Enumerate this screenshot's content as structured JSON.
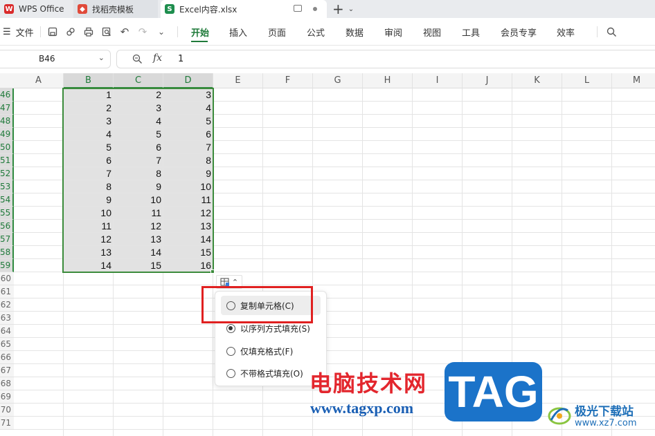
{
  "tabs": {
    "wps": "WPS Office",
    "template": "找稻壳模板",
    "file": "Excel内容.xlsx",
    "file_icon": "S"
  },
  "ribbon": {
    "file_menu": "文件",
    "menus": [
      "开始",
      "插入",
      "页面",
      "公式",
      "数据",
      "审阅",
      "视图",
      "工具",
      "会员专享",
      "效率"
    ]
  },
  "formula_bar": {
    "cell_ref": "B46",
    "fx": "fx",
    "value": "1"
  },
  "sheet": {
    "columns": [
      "A",
      "B",
      "C",
      "D",
      "E",
      "F",
      "G",
      "H",
      "I",
      "J",
      "K",
      "L",
      "M"
    ],
    "rows": [
      "46",
      "47",
      "48",
      "49",
      "50",
      "51",
      "52",
      "53",
      "54",
      "55",
      "56",
      "57",
      "58",
      "59",
      "60",
      "61",
      "62",
      "63",
      "64",
      "65",
      "66",
      "67",
      "68",
      "69",
      "70",
      "71"
    ],
    "data": [
      [
        "1",
        "2",
        "3"
      ],
      [
        "2",
        "3",
        "4"
      ],
      [
        "3",
        "4",
        "5"
      ],
      [
        "4",
        "5",
        "6"
      ],
      [
        "5",
        "6",
        "7"
      ],
      [
        "6",
        "7",
        "8"
      ],
      [
        "7",
        "8",
        "9"
      ],
      [
        "8",
        "9",
        "10"
      ],
      [
        "9",
        "10",
        "11"
      ],
      [
        "10",
        "11",
        "12"
      ],
      [
        "11",
        "12",
        "13"
      ],
      [
        "12",
        "13",
        "14"
      ],
      [
        "13",
        "14",
        "15"
      ],
      [
        "14",
        "15",
        "16"
      ]
    ]
  },
  "paste_options": {
    "items": [
      "复制单元格(C)",
      "以序列方式填充(S)",
      "仅填充格式(F)",
      "不带格式填充(O)"
    ],
    "selected_index": 1
  },
  "watermark": {
    "site_cn": "电脑技术网",
    "site_url": "www.tagxp.com",
    "tag": "TAG",
    "xz_name": "极光下载站",
    "xz_url": "www.xz7.com"
  },
  "colors": {
    "accent_green": "#1f7a3a",
    "highlight_red": "#e02020",
    "tag_blue": "#1b73c9"
  }
}
